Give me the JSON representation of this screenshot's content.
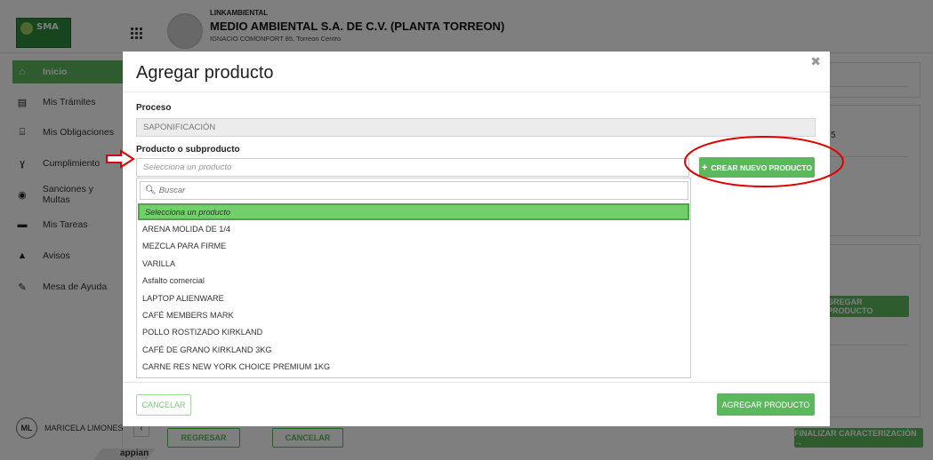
{
  "header": {
    "org_top": "LINKAMBIENTAL",
    "company_name": "MEDIO AMBIENTAL S.A. DE C.V. (PLANTA TORREON)",
    "company_address": "IGNACIO COMONFORT 85, Torreon Centro",
    "logo_text": "SMA"
  },
  "sidebar": {
    "items": [
      {
        "label": "Inicio",
        "icon": "home-icon",
        "glyph": "⌂"
      },
      {
        "label": "Mis Trámites",
        "icon": "document-icon",
        "glyph": "▤"
      },
      {
        "label": "Mis Obligaciones",
        "icon": "institution-icon",
        "glyph": "⌸"
      },
      {
        "label": "Cumplimiento",
        "icon": "tie-icon",
        "glyph": "ɣ"
      },
      {
        "label": "Sanciones y Multas",
        "icon": "user-secret-icon",
        "glyph": "◉"
      },
      {
        "label": "Mis Tareas",
        "icon": "briefcase-icon",
        "glyph": "▬"
      },
      {
        "label": "Avisos",
        "icon": "warning-icon",
        "glyph": "▲"
      },
      {
        "label": "Mesa de Ayuda",
        "icon": "wrench-icon",
        "glyph": "✎"
      }
    ],
    "user_initials": "ML",
    "user_name": "MARICELA LIMONES",
    "brand": "appian"
  },
  "background": {
    "snippet_5": "5",
    "agregar_producto_partial": "GREGAR PRODUCTO",
    "regresar": "REGRESAR",
    "cancelar": "CANCELAR",
    "finalizar": "FINALIZAR CARACTERIZACIÓN →"
  },
  "modal": {
    "title": "Agregar producto",
    "close": "✖",
    "proceso_label": "Proceso",
    "proceso_value": "SAPONIFICACIÓN",
    "producto_label": "Producto o subproducto",
    "select_placeholder": "Selecciona un producto",
    "search_placeholder": "Buscar",
    "options": [
      "Selecciona un producto",
      "ARENA MOLIDA DE 1/4",
      "MEZCLA PARA FIRME",
      "VARILLA",
      "Asfalto comercial",
      "LAPTOP ALIENWARE",
      "CAFÉ MEMBERS MARK",
      "POLLO ROSTIZADO KIRKLAND",
      "CAFÉ DE GRANO KIRKLAND 3KG",
      "CARNE RES NEW YORK CHOICE PREMIUM 1KG"
    ],
    "crear_nuevo_producto": "CREAR NUEVO PRODUCTO",
    "cancelar": "CANCELAR",
    "agregar_producto": "AGREGAR PRODUCTO"
  },
  "colors": {
    "accent_green": "#5cb85c",
    "annotation_red": "#e00000"
  }
}
